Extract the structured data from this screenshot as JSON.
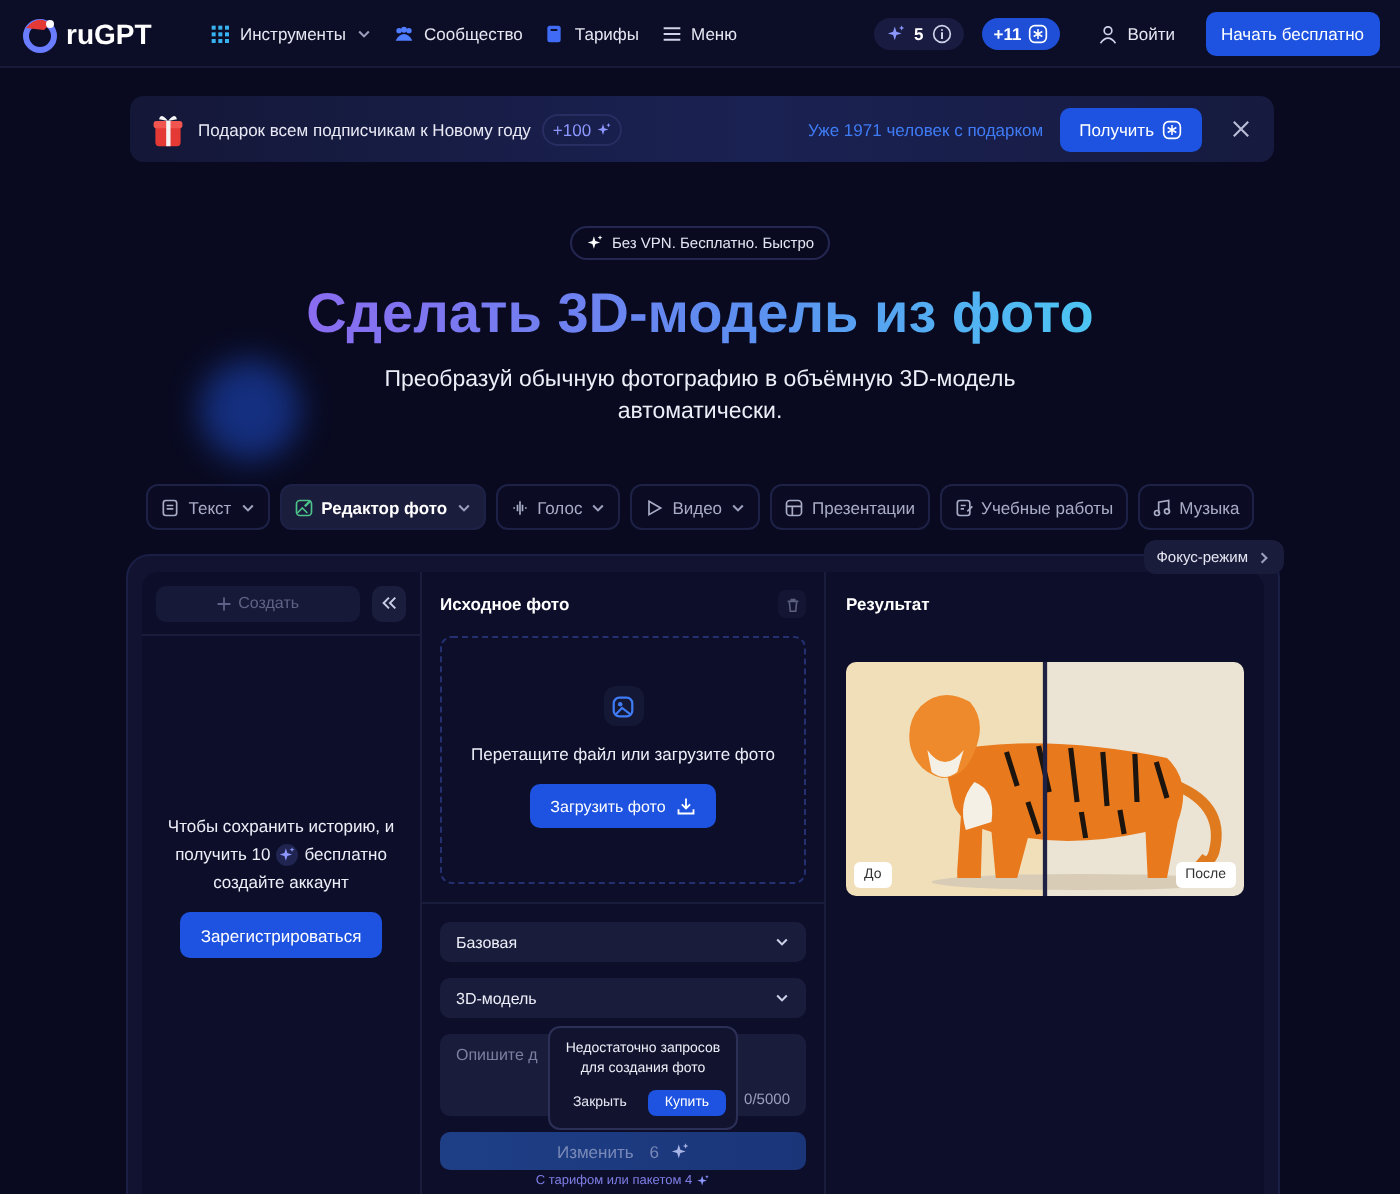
{
  "header": {
    "logo": "ruGPT",
    "nav": [
      {
        "label": "Инструменты",
        "kind": "grid",
        "dropdown": true
      },
      {
        "label": "Сообщество",
        "kind": "people",
        "dropdown": false
      },
      {
        "label": "Тарифы",
        "kind": "book",
        "dropdown": false
      },
      {
        "label": "Меню",
        "kind": "menu",
        "dropdown": false
      }
    ],
    "credits": "5",
    "bonus": "+11",
    "login": "Войти",
    "cta": "Начать бесплатно"
  },
  "banner": {
    "text": "Подарок всем подписчикам к Новому году",
    "bonus": "+100",
    "counter": "Уже 1971 человек с подарком",
    "button": "Получить"
  },
  "hero": {
    "badge": "Без VPN. Бесплатно. Быстро",
    "title": "Сделать 3D-модель из фото",
    "subtitle": "Преобразуй обычную фотографию в объёмную 3D-модель автоматически."
  },
  "tools": [
    {
      "label": "Текст",
      "kind": "text",
      "dropdown": true,
      "selected": false
    },
    {
      "label": "Редактор фото",
      "dropdown": true,
      "selected": true
    },
    {
      "label": "Голос",
      "kind": "voice",
      "dropdown": true,
      "selected": false
    },
    {
      "label": "Видео",
      "kind": "video",
      "dropdown": true,
      "selected": false
    },
    {
      "label": "Презентации",
      "kind": "slides",
      "dropdown": false,
      "selected": false
    },
    {
      "label": "Учебные работы",
      "kind": "study",
      "dropdown": false,
      "selected": false
    },
    {
      "label": "Музыка",
      "kind": "music",
      "dropdown": false,
      "selected": false
    }
  ],
  "workspace": {
    "focus": "Фокус-режим",
    "create": "Создать",
    "prompt": [
      {
        "text": "Чтобы сохранить историю, и"
      },
      {
        "text": "получить 10"
      },
      {
        "text": "бесплатно"
      },
      {
        "text": "создайте аккаунт"
      }
    ],
    "register": "Зарегистрироваться",
    "source": {
      "title": "Исходное фото",
      "drop_text": "Перетащите файл или загрузите фото",
      "upload": "Загрузить фото"
    },
    "selects": [
      {
        "value": "Базовая"
      },
      {
        "value": "3D-модель"
      }
    ],
    "textarea": {
      "placeholder": "Опишите д",
      "counter": "0/5000"
    },
    "popover": {
      "text": "Недостаточно запросов для создания фото",
      "close": "Закрыть",
      "buy": "Купить"
    },
    "submit": {
      "label": "Изменить",
      "cost": "6",
      "disabled": true
    },
    "note": "С тарифом или пакетом 4",
    "result": {
      "title": "Результат",
      "before": "До",
      "after": "После"
    }
  }
}
